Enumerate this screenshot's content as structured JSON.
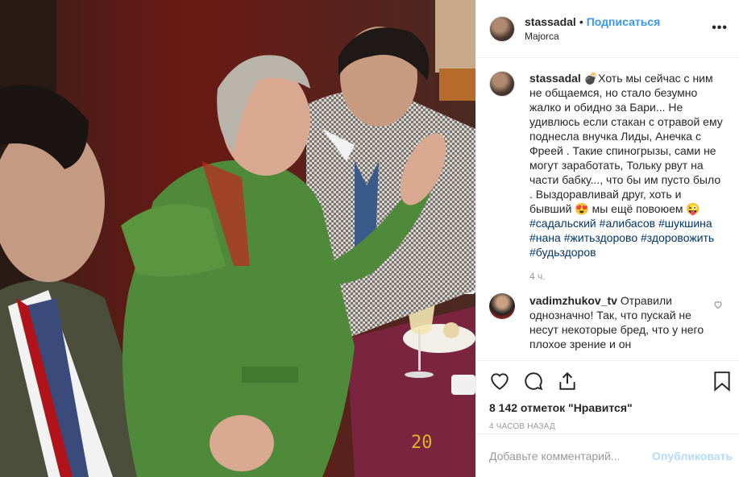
{
  "header": {
    "username": "stassadal",
    "separator": "•",
    "follow_label": "Подписаться",
    "location": "Majorca",
    "more_label": "•••"
  },
  "caption": {
    "username": "stassadal",
    "text": "💣Хоть мы сейчас с ним не общаемся, но стало безумно жалко и обидно за Бари... Не удивлюсь если стакан с отравой ему поднесла внучка Лиды, Анечка с Фреей . Такие спиногрызы, сами не могут заработать, Тольку рвут на части бабку..., что бы им пусто было . Выздоравливай друг, хоть и бывший 😍 мы ещё повоюем 😜",
    "hashtags": [
      "#садальский",
      "#алибасов",
      "#шукшина",
      "#нана",
      "#житьздорово",
      "#здоровожить",
      "#будьздоров"
    ],
    "time": "4 ч."
  },
  "comment": {
    "username": "vadimzhukov_tv",
    "text": "Отравили однозначно! Так, что пускай не несут некоторые бред, что у него плохое зрение и он"
  },
  "actions": {
    "likes": "8 142 отметок \"Нравится\"",
    "ago": "4 часов назад"
  },
  "add_comment": {
    "placeholder": "Добавьте комментарий...",
    "post_label": "Опубликовать"
  },
  "photo": {
    "number": "20"
  },
  "colors": {
    "accent": "#3897f0",
    "hashtag": "#003569",
    "muted": "#999999"
  }
}
